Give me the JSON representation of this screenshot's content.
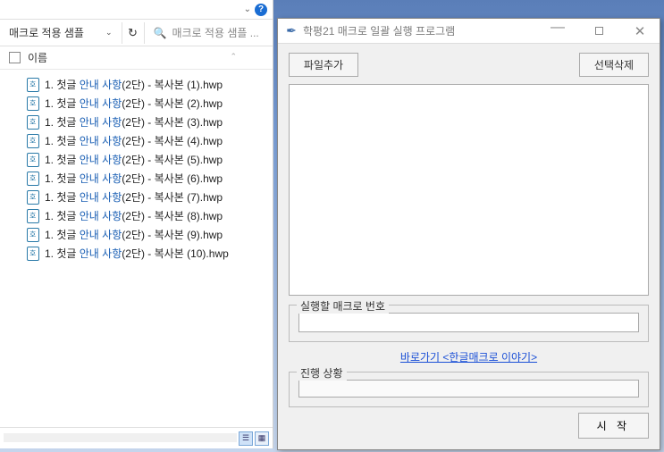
{
  "explorer": {
    "dropdown_label": "매크로 적용 샘플",
    "search_placeholder": "매크로 적용 샘플 ...",
    "column_name": "이름",
    "files": [
      {
        "prefix": "1. 첫글 ",
        "mid": "안내 사항",
        "suffix": "(2단) - 복사본 (1).hwp"
      },
      {
        "prefix": "1. 첫글 ",
        "mid": "안내 사항",
        "suffix": "(2단) - 복사본 (2).hwp"
      },
      {
        "prefix": "1. 첫글 ",
        "mid": "안내 사항",
        "suffix": "(2단) - 복사본 (3).hwp"
      },
      {
        "prefix": "1. 첫글 ",
        "mid": "안내 사항",
        "suffix": "(2단) - 복사본 (4).hwp"
      },
      {
        "prefix": "1. 첫글 ",
        "mid": "안내 사항",
        "suffix": "(2단) - 복사본 (5).hwp"
      },
      {
        "prefix": "1. 첫글 ",
        "mid": "안내 사항",
        "suffix": "(2단) - 복사본 (6).hwp"
      },
      {
        "prefix": "1. 첫글 ",
        "mid": "안내 사항",
        "suffix": "(2단) - 복사본 (7).hwp"
      },
      {
        "prefix": "1. 첫글 ",
        "mid": "안내 사항",
        "suffix": "(2단) - 복사본 (8).hwp"
      },
      {
        "prefix": "1. 첫글 ",
        "mid": "안내 사항",
        "suffix": "(2단) - 복사본 (9).hwp"
      },
      {
        "prefix": "1. 첫글 ",
        "mid": "안내 사항",
        "suffix": "(2단) - 복사본 (10).hwp"
      }
    ]
  },
  "app": {
    "title": "학평21 매크로 일괄 실행 프로그램",
    "btn_add": "파일추가",
    "btn_delete": "선택삭제",
    "field_macro_label": "실행할 매크로 번호",
    "field_macro_value": "",
    "link_text": "바로가기 <한글매크로 이야기>",
    "field_progress_label": "진행 상황",
    "btn_start": "시 작"
  }
}
